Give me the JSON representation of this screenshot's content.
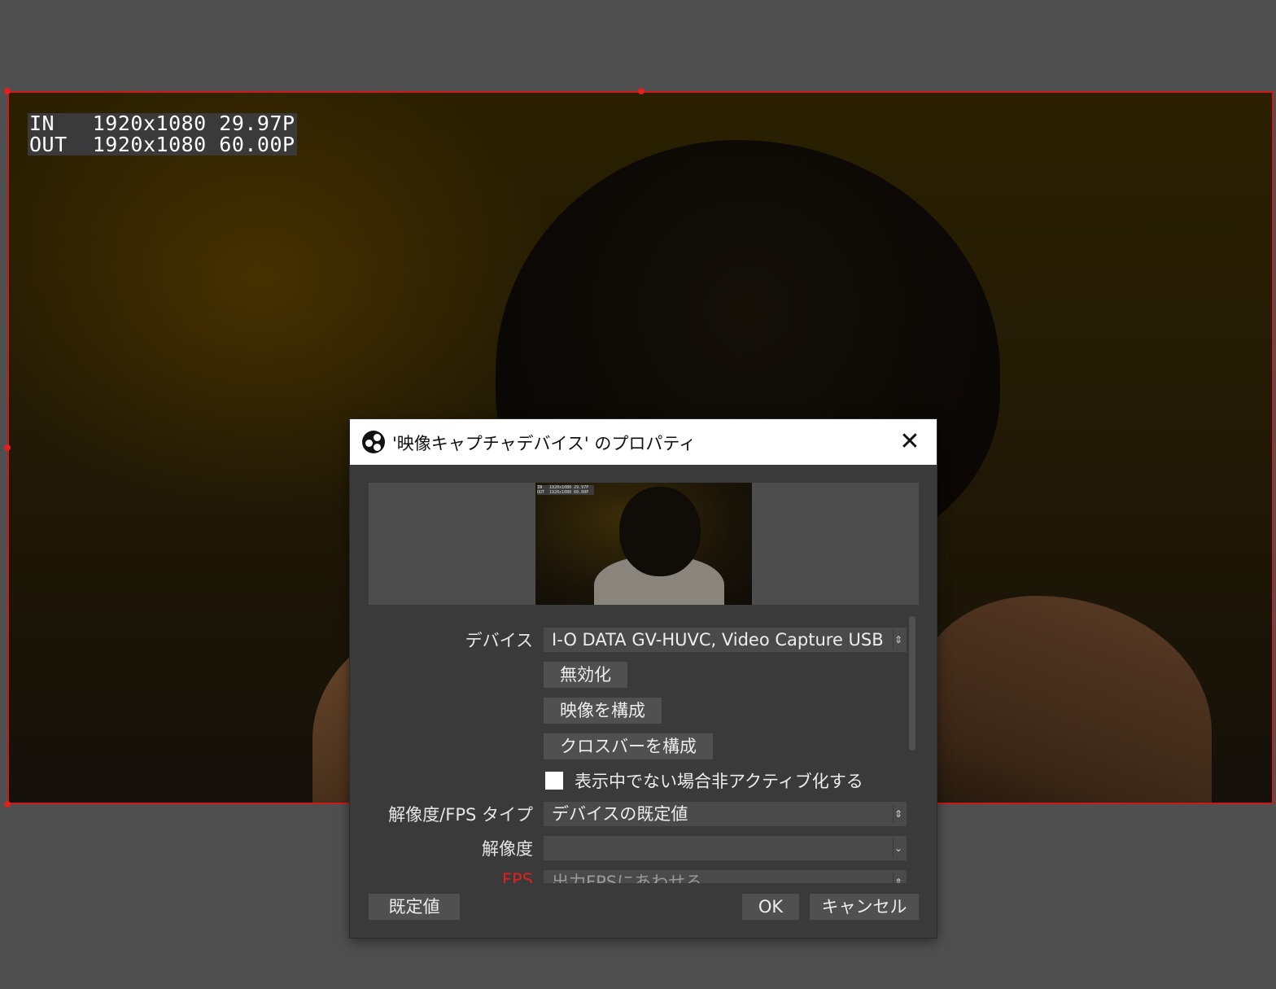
{
  "preview": {
    "osd_line1": "IN   1920x1080 29.97P",
    "osd_line2": "OUT  1920x1080 60.00P"
  },
  "dialog": {
    "title": "'映像キャプチャデバイス' のプロパティ",
    "close_icon": "close-icon",
    "properties": {
      "device_label": "デバイス",
      "device_value": "I-O DATA GV-HUVC, Video Capture USB",
      "disable_button": "無効化",
      "configure_video_button": "映像を構成",
      "configure_crossbar_button": "クロスバーを構成",
      "deactivate_checkbox_label": "表示中でない場合非アクティブ化する",
      "deactivate_checked": false,
      "res_fps_type_label": "解像度/FPS タイプ",
      "res_fps_type_value": "デバイスの既定値",
      "resolution_label": "解像度",
      "resolution_value": "",
      "fps_label": "FPS",
      "fps_value": "出力FPSにあわせる"
    },
    "footer": {
      "defaults_button": "既定値",
      "ok_button": "OK",
      "cancel_button": "キャンセル"
    }
  },
  "colors": {
    "selection_border": "#cc1a1a",
    "fps_label": "#e02020",
    "dialog_bg": "#3a3a3a",
    "canvas_bg": "#4f4f4f"
  }
}
